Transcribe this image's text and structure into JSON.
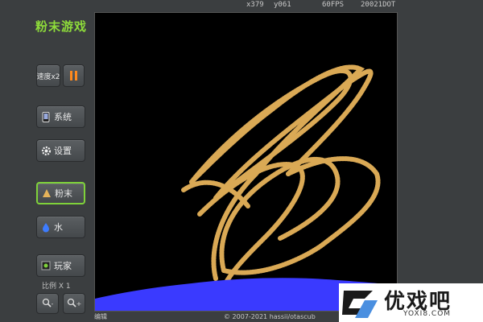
{
  "app": {
    "title": "粉末游戏"
  },
  "toolbar": {
    "speed_label": "速度x2",
    "pause_icon": "pause-icon"
  },
  "menu": {
    "system_label": "系统",
    "settings_label": "设置",
    "powder_label": "粉末",
    "water_label": "水",
    "player_label": "玩家"
  },
  "zoom": {
    "scale_label": "比例 X 1",
    "zoom_out_label": "-",
    "zoom_in_label": "+"
  },
  "status": {
    "x": "x379",
    "y": "y061",
    "fps": "60FPS",
    "dots": "20021DOT"
  },
  "footer": {
    "edit_label": "编辑",
    "copyright": "© 2007-2021 hassii/otascub"
  },
  "watermark": {
    "brand": "优戏吧",
    "url": "YOXI8.COM"
  },
  "colors": {
    "accent": "#8edc3a",
    "powder": "#e6b35a",
    "water": "#3a3aff",
    "pause": "#ff8a1e"
  }
}
